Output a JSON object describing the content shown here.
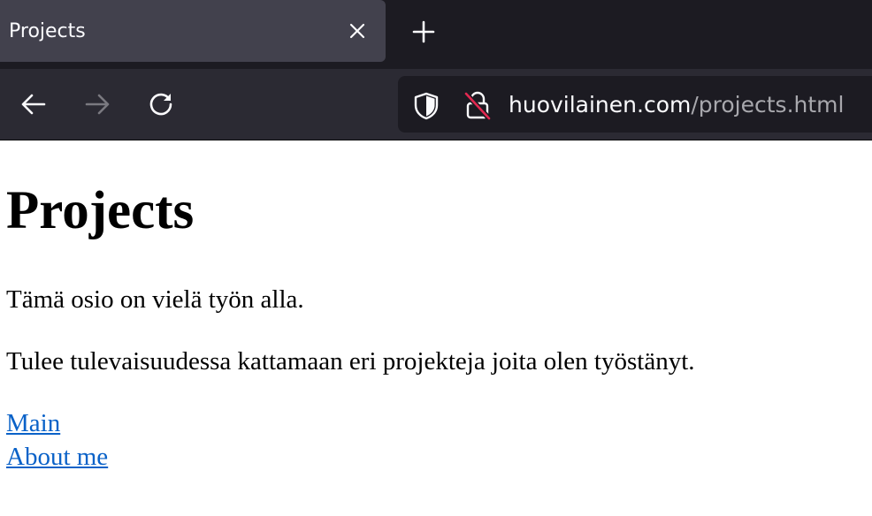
{
  "browser": {
    "tab": {
      "title": "Projects"
    },
    "url": {
      "domain": "huovilainen.com",
      "path": "/projects.html"
    }
  },
  "page": {
    "title": "Projects",
    "paragraphs": [
      "Tämä osio on vielä työn alla.",
      "Tulee tulevaisuudessa kattamaan eri projekteja joita olen työstänyt."
    ],
    "links": [
      "Main",
      "About me"
    ]
  },
  "icons": {
    "tab_close": "close-icon",
    "new_tab": "plus-icon",
    "back": "arrow-left-icon",
    "forward": "arrow-right-icon",
    "reload": "reload-icon",
    "tracking_protection": "shield-icon",
    "insecure_connection": "lock-crossed-icon"
  },
  "colors": {
    "tab_strip": "#1c1b22",
    "active_tab": "#42414d",
    "toolbar": "#2b2a33",
    "urlbar": "#1c1b22",
    "link": "#0a62c8",
    "insecure_strike": "#e22850"
  }
}
